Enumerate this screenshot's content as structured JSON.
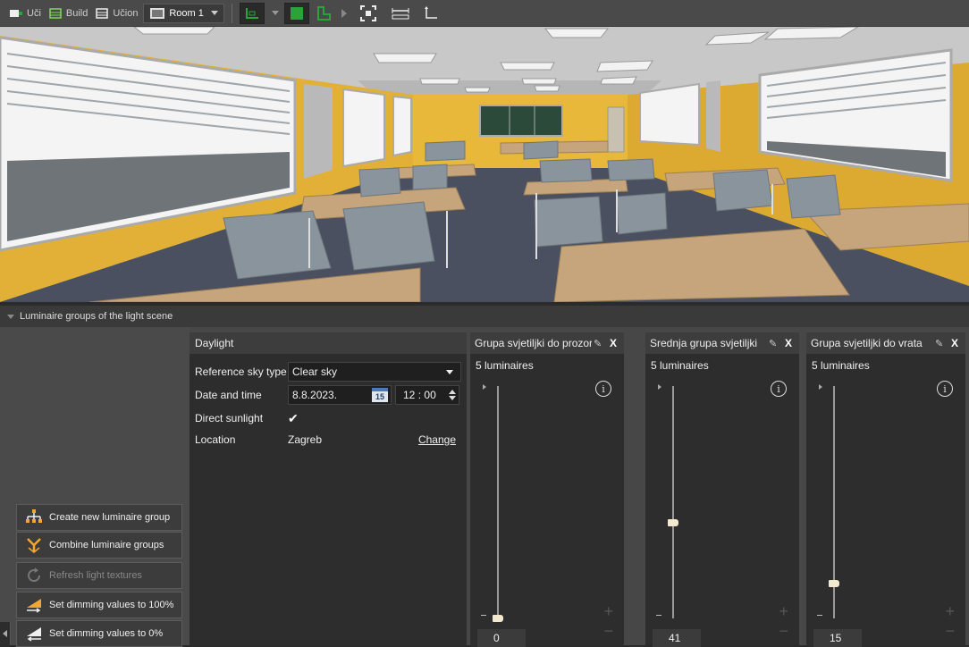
{
  "toolbar": {
    "breadcrumbs": [
      {
        "label": "Uči",
        "icon": "project-icon"
      },
      {
        "label": "Build",
        "icon": "building-icon"
      },
      {
        "label": "Učion",
        "icon": "floor-icon"
      }
    ],
    "room_selector": {
      "label": "Room 1",
      "icon": "room-icon"
    },
    "tools": [
      "view-mode-icon",
      "solid-view-icon",
      "floor-plan-icon",
      "fit-view-icon",
      "measure-icon",
      "axis-icon"
    ]
  },
  "panel_title": "Luminaire groups of the light scene",
  "daylight": {
    "title": "Daylight",
    "reference_sky_type_label": "Reference sky type",
    "reference_sky_type_value": "Clear sky",
    "date_time_label": "Date and time",
    "date_value": "8.8.2023.",
    "calendar_day": "15",
    "time_hour": "12",
    "time_sep": ":",
    "time_minute": "00",
    "direct_sunlight_label": "Direct sunlight",
    "direct_sunlight_checked": true,
    "location_label": "Location",
    "location_value": "Zagreb",
    "change_link": "Change"
  },
  "groups": [
    {
      "title": "Grupa svjetiljki do prozora",
      "count": "5 luminaires",
      "dimming": "0",
      "dimming_fraction": 0.0
    },
    {
      "title": "Srednja grupa svjetiljki",
      "count": "5 luminaires",
      "dimming": "41",
      "dimming_fraction": 0.41
    },
    {
      "title": "Grupa svjetiljki do vrata",
      "count": "5 luminaires",
      "dimming": "15",
      "dimming_fraction": 0.15
    }
  ],
  "group_controls": {
    "close": "X",
    "edit_icon": "pencil-icon",
    "info_icon": "info-icon",
    "info_glyph": "i",
    "plus": "+",
    "minus": "−"
  },
  "actions": [
    {
      "label": "Create new luminaire group",
      "icon": "hierarchy-icon",
      "enabled": true
    },
    {
      "label": "Combine luminaire groups",
      "icon": "combine-icon",
      "enabled": true
    },
    {
      "label": "Refresh light textures",
      "icon": "refresh-icon",
      "enabled": false
    },
    {
      "label": "Set dimming values to 100%",
      "icon": "dim-up-icon",
      "enabled": true
    },
    {
      "label": "Set dimming values to 0%",
      "icon": "dim-down-icon",
      "enabled": true
    }
  ],
  "colors": {
    "wall": "#e8b83a",
    "ceiling": "#d4d4d4",
    "floor": "#4a5060",
    "table": "#c6a57c",
    "chair": "#8a949c",
    "accent_green": "#2aa43a"
  }
}
